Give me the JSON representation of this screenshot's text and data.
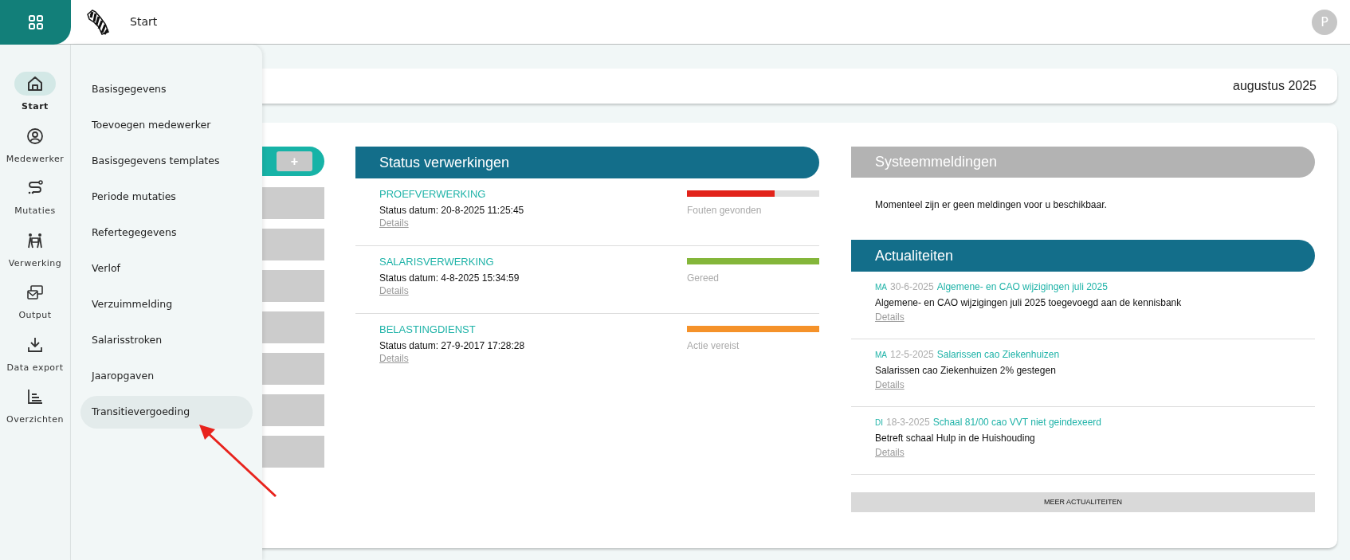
{
  "topbar": {
    "title": "Start",
    "avatar": "P"
  },
  "nav": [
    {
      "label": "Start",
      "selected": true
    },
    {
      "label": "Medewerker",
      "selected": false
    },
    {
      "label": "Mutaties",
      "selected": false
    },
    {
      "label": "Verwerking",
      "selected": false
    },
    {
      "label": "Output",
      "selected": false
    },
    {
      "label": "Data export",
      "selected": false
    },
    {
      "label": "Overzichten",
      "selected": false
    }
  ],
  "submenu": [
    {
      "label": "Basisgegevens",
      "selected": false
    },
    {
      "label": "Toevoegen medewerker",
      "selected": false
    },
    {
      "label": "Basisgegevens templates",
      "selected": false
    },
    {
      "label": "Periode mutaties",
      "selected": false
    },
    {
      "label": "Refertegegevens",
      "selected": false
    },
    {
      "label": "Verlof",
      "selected": false
    },
    {
      "label": "Verzuimmelding",
      "selected": false
    },
    {
      "label": "Salarisstroken",
      "selected": false
    },
    {
      "label": "Jaaropgaven",
      "selected": false
    },
    {
      "label": "Transitievergoeding",
      "selected": true
    }
  ],
  "period": "augustus 2025",
  "left_panel": {
    "add_button": "+"
  },
  "status": {
    "title": "Status verwerkingen",
    "items": [
      {
        "name": "PROEFVERWERKING",
        "date": "Status datum: 20-8-2025 11:25:45",
        "link": "Details",
        "level": 0.66,
        "color": "#e2231a",
        "state": "Fouten gevonden"
      },
      {
        "name": "SALARISVERWERKING",
        "date": "Status datum: 4-8-2025 15:34:59",
        "link": "Details",
        "level": 1,
        "color": "#84b63a",
        "state": "Gereed"
      },
      {
        "name": "BELASTINGDIENST",
        "date": "Status datum: 27-9-2017 17:28:28",
        "link": "Details",
        "level": 1,
        "color": "#f5922a",
        "state": "Actie vereist"
      }
    ]
  },
  "system": {
    "title": "Systeemmeldingen",
    "message": "Momenteel zijn er geen meldingen voor u beschikbaar."
  },
  "news": {
    "title": "Actualiteiten",
    "items": [
      {
        "day": "MA",
        "date": "30-6-2025",
        "headline": "Algemene- en CAO wijzigingen juli 2025",
        "text": "Algemene- en CAO wijzigingen juli 2025 toegevoegd aan de kennisbank",
        "link": "Details"
      },
      {
        "day": "MA",
        "date": "12-5-2025",
        "headline": "Salarissen cao Ziekenhuizen",
        "text": "Salarissen cao Ziekenhuizen 2% gestegen",
        "link": "Details"
      },
      {
        "day": "DI",
        "date": "18-3-2025",
        "headline": "Schaal 81/00 cao VVT niet geindexeerd",
        "text": "Betreft schaal Hulp in de Huishouding",
        "link": "Details"
      }
    ],
    "more": "MEER ACTUALITEITEN"
  }
}
